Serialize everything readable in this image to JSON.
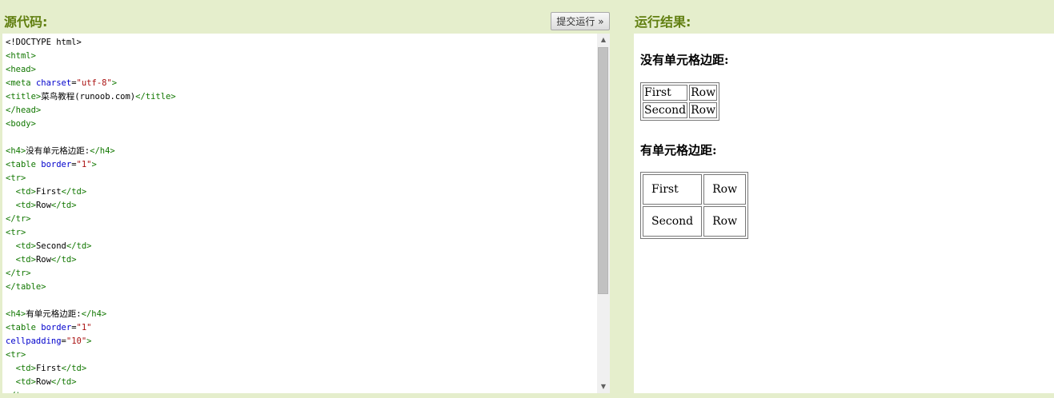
{
  "source_panel": {
    "title": "源代码:",
    "submit_label": "提交运行 »"
  },
  "editor": {
    "lines": [
      [
        {
          "c": "p",
          "t": "<!DOCTYPE html>"
        }
      ],
      [
        {
          "c": "tg",
          "t": "<html>"
        }
      ],
      [
        {
          "c": "tg",
          "t": "<head>"
        }
      ],
      [
        {
          "c": "tg",
          "t": "<meta "
        },
        {
          "c": "at",
          "t": "charset"
        },
        {
          "c": "p",
          "t": "="
        },
        {
          "c": "st",
          "t": "\"utf-8\""
        },
        {
          "c": "tg",
          "t": ">"
        }
      ],
      [
        {
          "c": "tg",
          "t": "<title>"
        },
        {
          "c": "p",
          "t": "菜鸟教程(runoob.com)"
        },
        {
          "c": "tg",
          "t": "</title>"
        }
      ],
      [
        {
          "c": "tg",
          "t": "</head>"
        }
      ],
      [
        {
          "c": "tg",
          "t": "<body>"
        }
      ],
      [],
      [
        {
          "c": "tg",
          "t": "<h4>"
        },
        {
          "c": "p",
          "t": "没有单元格边距:"
        },
        {
          "c": "tg",
          "t": "</h4>"
        }
      ],
      [
        {
          "c": "tg",
          "t": "<table "
        },
        {
          "c": "at",
          "t": "border"
        },
        {
          "c": "p",
          "t": "="
        },
        {
          "c": "st",
          "t": "\"1\""
        },
        {
          "c": "tg",
          "t": ">"
        }
      ],
      [
        {
          "c": "tg",
          "t": "<tr>"
        }
      ],
      [
        {
          "c": "p",
          "t": "  "
        },
        {
          "c": "tg",
          "t": "<td>"
        },
        {
          "c": "p",
          "t": "First"
        },
        {
          "c": "tg",
          "t": "</td>"
        }
      ],
      [
        {
          "c": "p",
          "t": "  "
        },
        {
          "c": "tg",
          "t": "<td>"
        },
        {
          "c": "p",
          "t": "Row"
        },
        {
          "c": "tg",
          "t": "</td>"
        }
      ],
      [
        {
          "c": "tg",
          "t": "</tr>"
        }
      ],
      [
        {
          "c": "tg",
          "t": "<tr>"
        }
      ],
      [
        {
          "c": "p",
          "t": "  "
        },
        {
          "c": "tg",
          "t": "<td>"
        },
        {
          "c": "p",
          "t": "Second"
        },
        {
          "c": "tg",
          "t": "</td>"
        }
      ],
      [
        {
          "c": "p",
          "t": "  "
        },
        {
          "c": "tg",
          "t": "<td>"
        },
        {
          "c": "p",
          "t": "Row"
        },
        {
          "c": "tg",
          "t": "</td>"
        }
      ],
      [
        {
          "c": "tg",
          "t": "</tr>"
        }
      ],
      [
        {
          "c": "tg",
          "t": "</table>"
        }
      ],
      [],
      [
        {
          "c": "tg",
          "t": "<h4>"
        },
        {
          "c": "p",
          "t": "有单元格边距:"
        },
        {
          "c": "tg",
          "t": "</h4>"
        }
      ],
      [
        {
          "c": "tg",
          "t": "<table "
        },
        {
          "c": "at",
          "t": "border"
        },
        {
          "c": "p",
          "t": "="
        },
        {
          "c": "st",
          "t": "\"1\""
        }
      ],
      [
        {
          "c": "at",
          "t": "cellpadding"
        },
        {
          "c": "p",
          "t": "="
        },
        {
          "c": "st",
          "t": "\"10\""
        },
        {
          "c": "tg",
          "t": ">"
        }
      ],
      [
        {
          "c": "tg",
          "t": "<tr>"
        }
      ],
      [
        {
          "c": "p",
          "t": "  "
        },
        {
          "c": "tg",
          "t": "<td>"
        },
        {
          "c": "p",
          "t": "First"
        },
        {
          "c": "tg",
          "t": "</td>"
        }
      ],
      [
        {
          "c": "p",
          "t": "  "
        },
        {
          "c": "tg",
          "t": "<td>"
        },
        {
          "c": "p",
          "t": "Row"
        },
        {
          "c": "tg",
          "t": "</td>"
        }
      ],
      [
        {
          "c": "tg",
          "t": "</tr>"
        }
      ]
    ],
    "scroll_up_icon": "▲",
    "scroll_down_icon": "▼"
  },
  "result_panel": {
    "title": "运行结果:",
    "heading_no_padding": "没有单元格边距:",
    "table_no_padding": [
      [
        "First",
        "Row"
      ],
      [
        "Second",
        "Row"
      ]
    ],
    "heading_padding": "有单元格边距:",
    "table_padding": [
      [
        "First",
        "Row"
      ],
      [
        "Second",
        "Row"
      ]
    ]
  },
  "colors": {
    "background": "#e5eecc",
    "title_green": "#617f10",
    "tag_green": "#117700",
    "attr_blue": "#0000cc",
    "string_red": "#aa1111"
  }
}
